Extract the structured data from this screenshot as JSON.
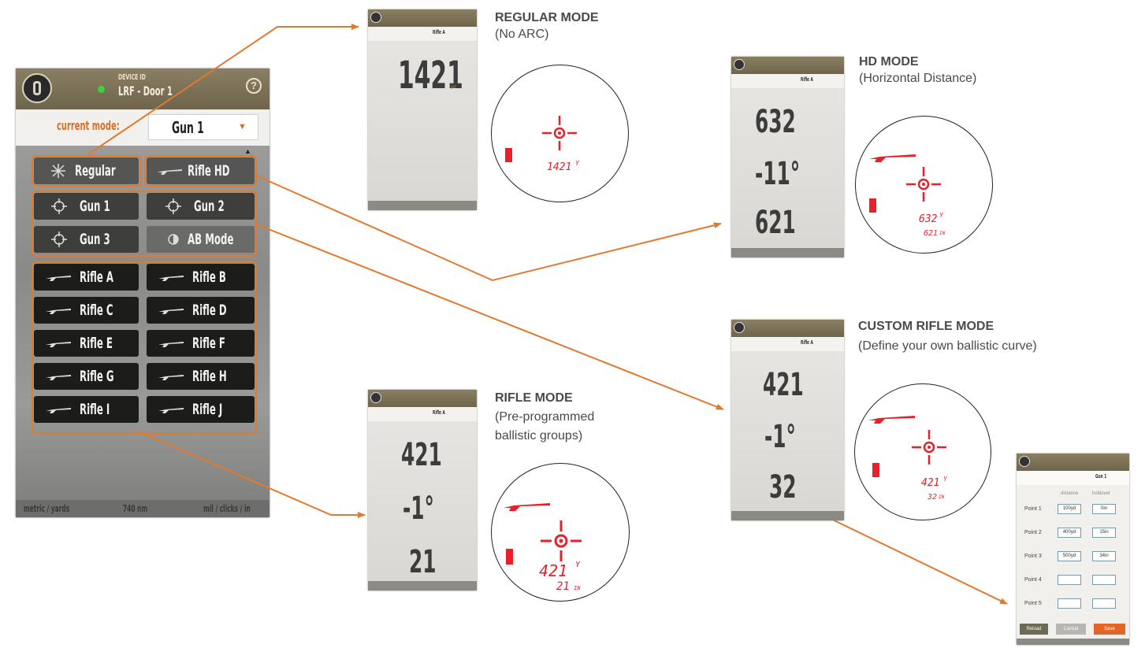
{
  "main_app": {
    "header": {
      "small_title": "DEVICE ID",
      "title": "LRF - Door 1",
      "help": "?"
    },
    "current_mode_label": "current mode:",
    "selected_mode": "Gun 1",
    "buttons": {
      "regular": "Regular",
      "rifle_hd": "Rifle HD",
      "gun1": "Gun 1",
      "gun2": "Gun 2",
      "gun3": "Gun 3",
      "ab_mode": "AB Mode",
      "rifles": [
        "Rifle A",
        "Rifle B",
        "Rifle C",
        "Rifle D",
        "Rifle E",
        "Rifle F",
        "Rifle G",
        "Rifle H",
        "Rifle I",
        "Rifle J"
      ]
    },
    "footer": {
      "left": "metric / yards",
      "middle": "740 nm",
      "right": "mil / clicks / in"
    }
  },
  "captions": {
    "regular": {
      "title": "REGULAR MODE",
      "subtitle": "(No ARC)"
    },
    "hd": {
      "title": "HD MODE",
      "subtitle": "(Horizontal Distance)"
    },
    "custom": {
      "title": "CUSTOM RIFLE MODE",
      "subtitle": "(Define your own ballistic curve)"
    },
    "rifle": {
      "title": "RIFLE MODE",
      "subtitle": "(Pre-programmed ballistic groups)"
    }
  },
  "thumbs": {
    "regular": {
      "distance": "1421",
      "unit": "yd",
      "selected": "Rifle A"
    },
    "hd": {
      "distance": "632",
      "angle": "-11°",
      "hd": "621",
      "selected": "Rifle A"
    },
    "custom": {
      "distance": "421",
      "angle": "-1°",
      "holdover": "32",
      "selected": "Rifle A"
    },
    "rifle": {
      "distance": "421",
      "angle": "-1°",
      "holdover": "21",
      "selected": "Rifle A"
    }
  },
  "scopes": {
    "regular": {
      "distance": "1421",
      "unit": "Y"
    },
    "hd": {
      "distance": "632",
      "unit": "Y",
      "hd": "621",
      "hd_unit": "IN"
    },
    "custom": {
      "distance": "421",
      "unit": "Y",
      "holdover": "32",
      "holdover_unit": "IN"
    },
    "rifle": {
      "distance": "421",
      "unit": "Y",
      "holdover": "21",
      "holdover_unit": "IN"
    }
  },
  "custom_form": {
    "selected": "Gun 1",
    "col1": "distance",
    "col2": "holdover",
    "rows": [
      {
        "label": "Point 1",
        "a": "100yd",
        "b": "0in"
      },
      {
        "label": "Point 2",
        "a": "400yd",
        "b": "15in"
      },
      {
        "label": "Point 3",
        "a": "500yd",
        "b": "34in"
      },
      {
        "label": "Point 4",
        "a": "",
        "b": ""
      },
      {
        "label": "Point 5",
        "a": "",
        "b": ""
      }
    ],
    "buttons": {
      "reload": "Reload",
      "cancel": "Cancel",
      "save": "Save"
    }
  },
  "colors": {
    "accent": "#e07a30",
    "reticle": "#e8202a",
    "header": "#7c7257"
  }
}
